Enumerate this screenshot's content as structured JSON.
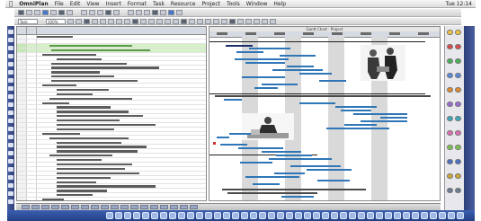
{
  "menubar": {
    "app_name": "OmniPlan",
    "menus": [
      "File",
      "Edit",
      "View",
      "Insert",
      "Format",
      "Task",
      "Resource",
      "Project",
      "Tools",
      "Window",
      "Help"
    ],
    "clock": "Tue 12:14"
  },
  "toolbar": {
    "zoom_value": "100%",
    "style_value": "Task"
  },
  "gantt": {
    "title": "Gantt Chart · Project"
  },
  "colors": {
    "bar": "#2f76b6",
    "dark_bar": "#1b2d6a",
    "highlight_row": "#d6f1c8",
    "shade": "#d9d9d9",
    "dock": "#2f3f7a"
  },
  "icons": {
    "apple": "apple-icon",
    "toolbar": [
      "new-doc-icon",
      "open-icon",
      "save-icon",
      "print-icon",
      "undo-icon",
      "redo-icon",
      "cut-icon",
      "copy-icon",
      "paste-icon",
      "indent-icon",
      "outdent-icon",
      "link-icon",
      "unlink-icon",
      "split-icon",
      "milestone-icon",
      "color-icon",
      "bold-icon",
      "italic-icon",
      "align-icon"
    ]
  }
}
